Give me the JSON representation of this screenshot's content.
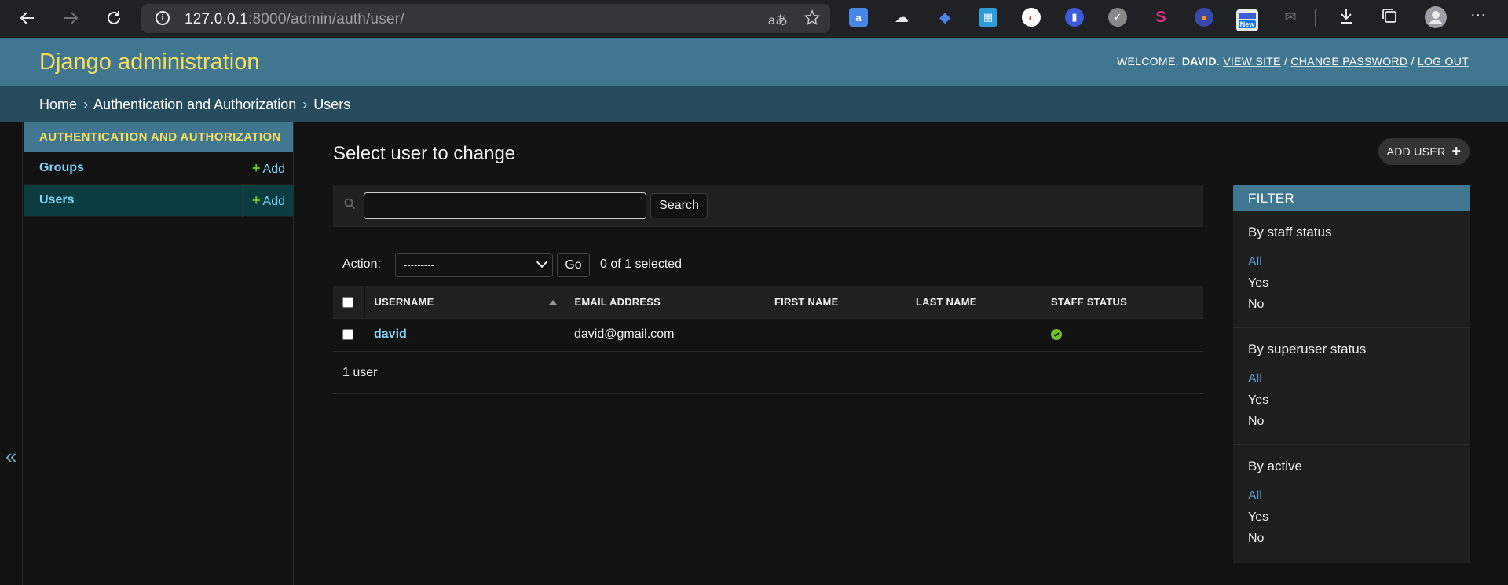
{
  "browser": {
    "url_host": "127.0.0.1",
    "url_rest": ":8000/admin/auth/user/",
    "extension_new_badge": "New"
  },
  "header": {
    "brand": "Django administration",
    "welcome": "Welcome,",
    "username": "David",
    "view_site": "View site",
    "change_password": "Change password",
    "log_out": "Log out"
  },
  "breadcrumbs": {
    "home": "Home",
    "app": "Authentication and Authorization",
    "current": "Users",
    "separator": "›"
  },
  "sidebar": {
    "toggle_glyph": "«",
    "app_caption": "Authentication and Authorization",
    "models": [
      {
        "name": "Groups",
        "add": "Add"
      },
      {
        "name": "Users",
        "add": "Add"
      }
    ]
  },
  "content": {
    "title": "Select user to change",
    "add_button": "Add user",
    "search": {
      "value": "",
      "button": "Search"
    },
    "actions": {
      "label": "Action:",
      "selected_option": "---------",
      "go": "Go",
      "selected_count": "0 of 1 selected"
    },
    "table": {
      "headers": [
        "Username",
        "Email address",
        "First name",
        "Last name",
        "Staff status"
      ],
      "rows": [
        {
          "username": "david",
          "email": "david@gmail.com",
          "first_name": "",
          "last_name": "",
          "staff_status": true
        }
      ]
    },
    "paginator": "1 user"
  },
  "filter": {
    "title": "Filter",
    "groups": [
      {
        "heading": "By staff status",
        "options": [
          "All",
          "Yes",
          "No"
        ],
        "active": "All"
      },
      {
        "heading": "By superuser status",
        "options": [
          "All",
          "Yes",
          "No"
        ],
        "active": "All"
      },
      {
        "heading": "By active",
        "options": [
          "All",
          "Yes",
          "No"
        ],
        "active": "All"
      }
    ]
  },
  "colors": {
    "header_bg": "#417690",
    "breadcrumb_bg": "#264b5d",
    "brand_yellow": "#f5dd5d",
    "link_blue": "#81d4fa",
    "add_green": "#70bf2b"
  }
}
